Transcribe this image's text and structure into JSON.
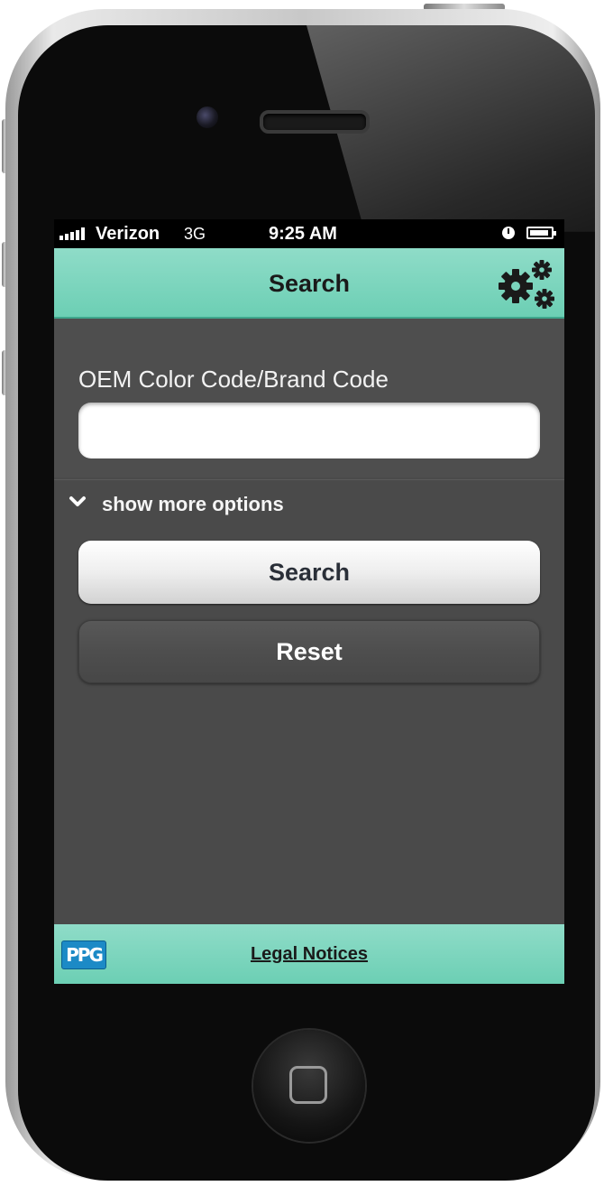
{
  "status_bar": {
    "carrier": "Verizon",
    "network": "3G",
    "time": "9:25 AM"
  },
  "header": {
    "title": "Search",
    "settings_icon": "gears-icon"
  },
  "form": {
    "field_label": "OEM Color Code/Brand Code",
    "field_value": "",
    "field_placeholder": ""
  },
  "options": {
    "toggle_label": "show more options",
    "toggle_icon": "chevron-down-icon"
  },
  "buttons": {
    "search_label": "Search",
    "reset_label": "Reset"
  },
  "footer": {
    "logo_text": "PPG",
    "legal_link": "Legal Notices"
  },
  "colors": {
    "accent_teal": "#6ccfb4",
    "background": "#4a4a4a",
    "logo_blue": "#1c8ac6"
  }
}
